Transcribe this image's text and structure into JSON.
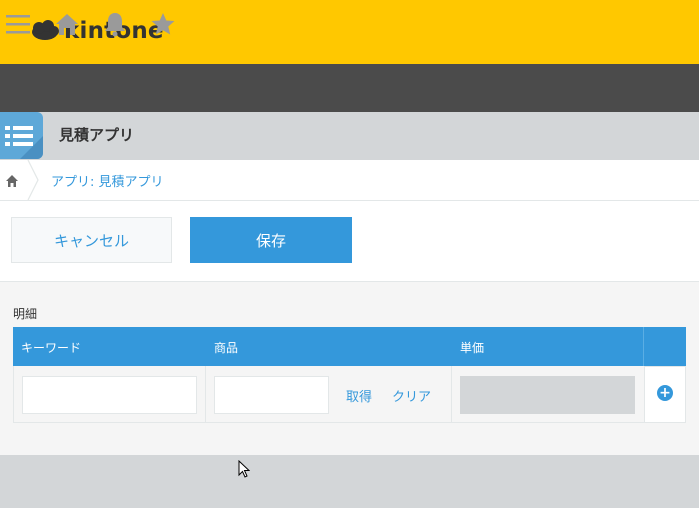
{
  "header": {
    "logo_text": "kintone"
  },
  "nav": {
    "icons": [
      "menu-icon",
      "home-icon",
      "bell-icon",
      "star-icon"
    ]
  },
  "app": {
    "title": "見積アプリ",
    "icon": "list-icon"
  },
  "breadcrumb": {
    "text": "アプリ: 見積アプリ"
  },
  "toolbar": {
    "cancel_label": "キャンセル",
    "save_label": "保存"
  },
  "form": {
    "section_label": "明細",
    "columns": [
      "キーワード",
      "商品",
      "単価"
    ],
    "row": {
      "keyword_value": "",
      "product_value": "",
      "fetch_label": "取得",
      "clear_label": "クリア",
      "price_value": ""
    }
  },
  "colors": {
    "header": "#ffc800",
    "nav": "#4b4b4b",
    "accent": "#3498db"
  }
}
